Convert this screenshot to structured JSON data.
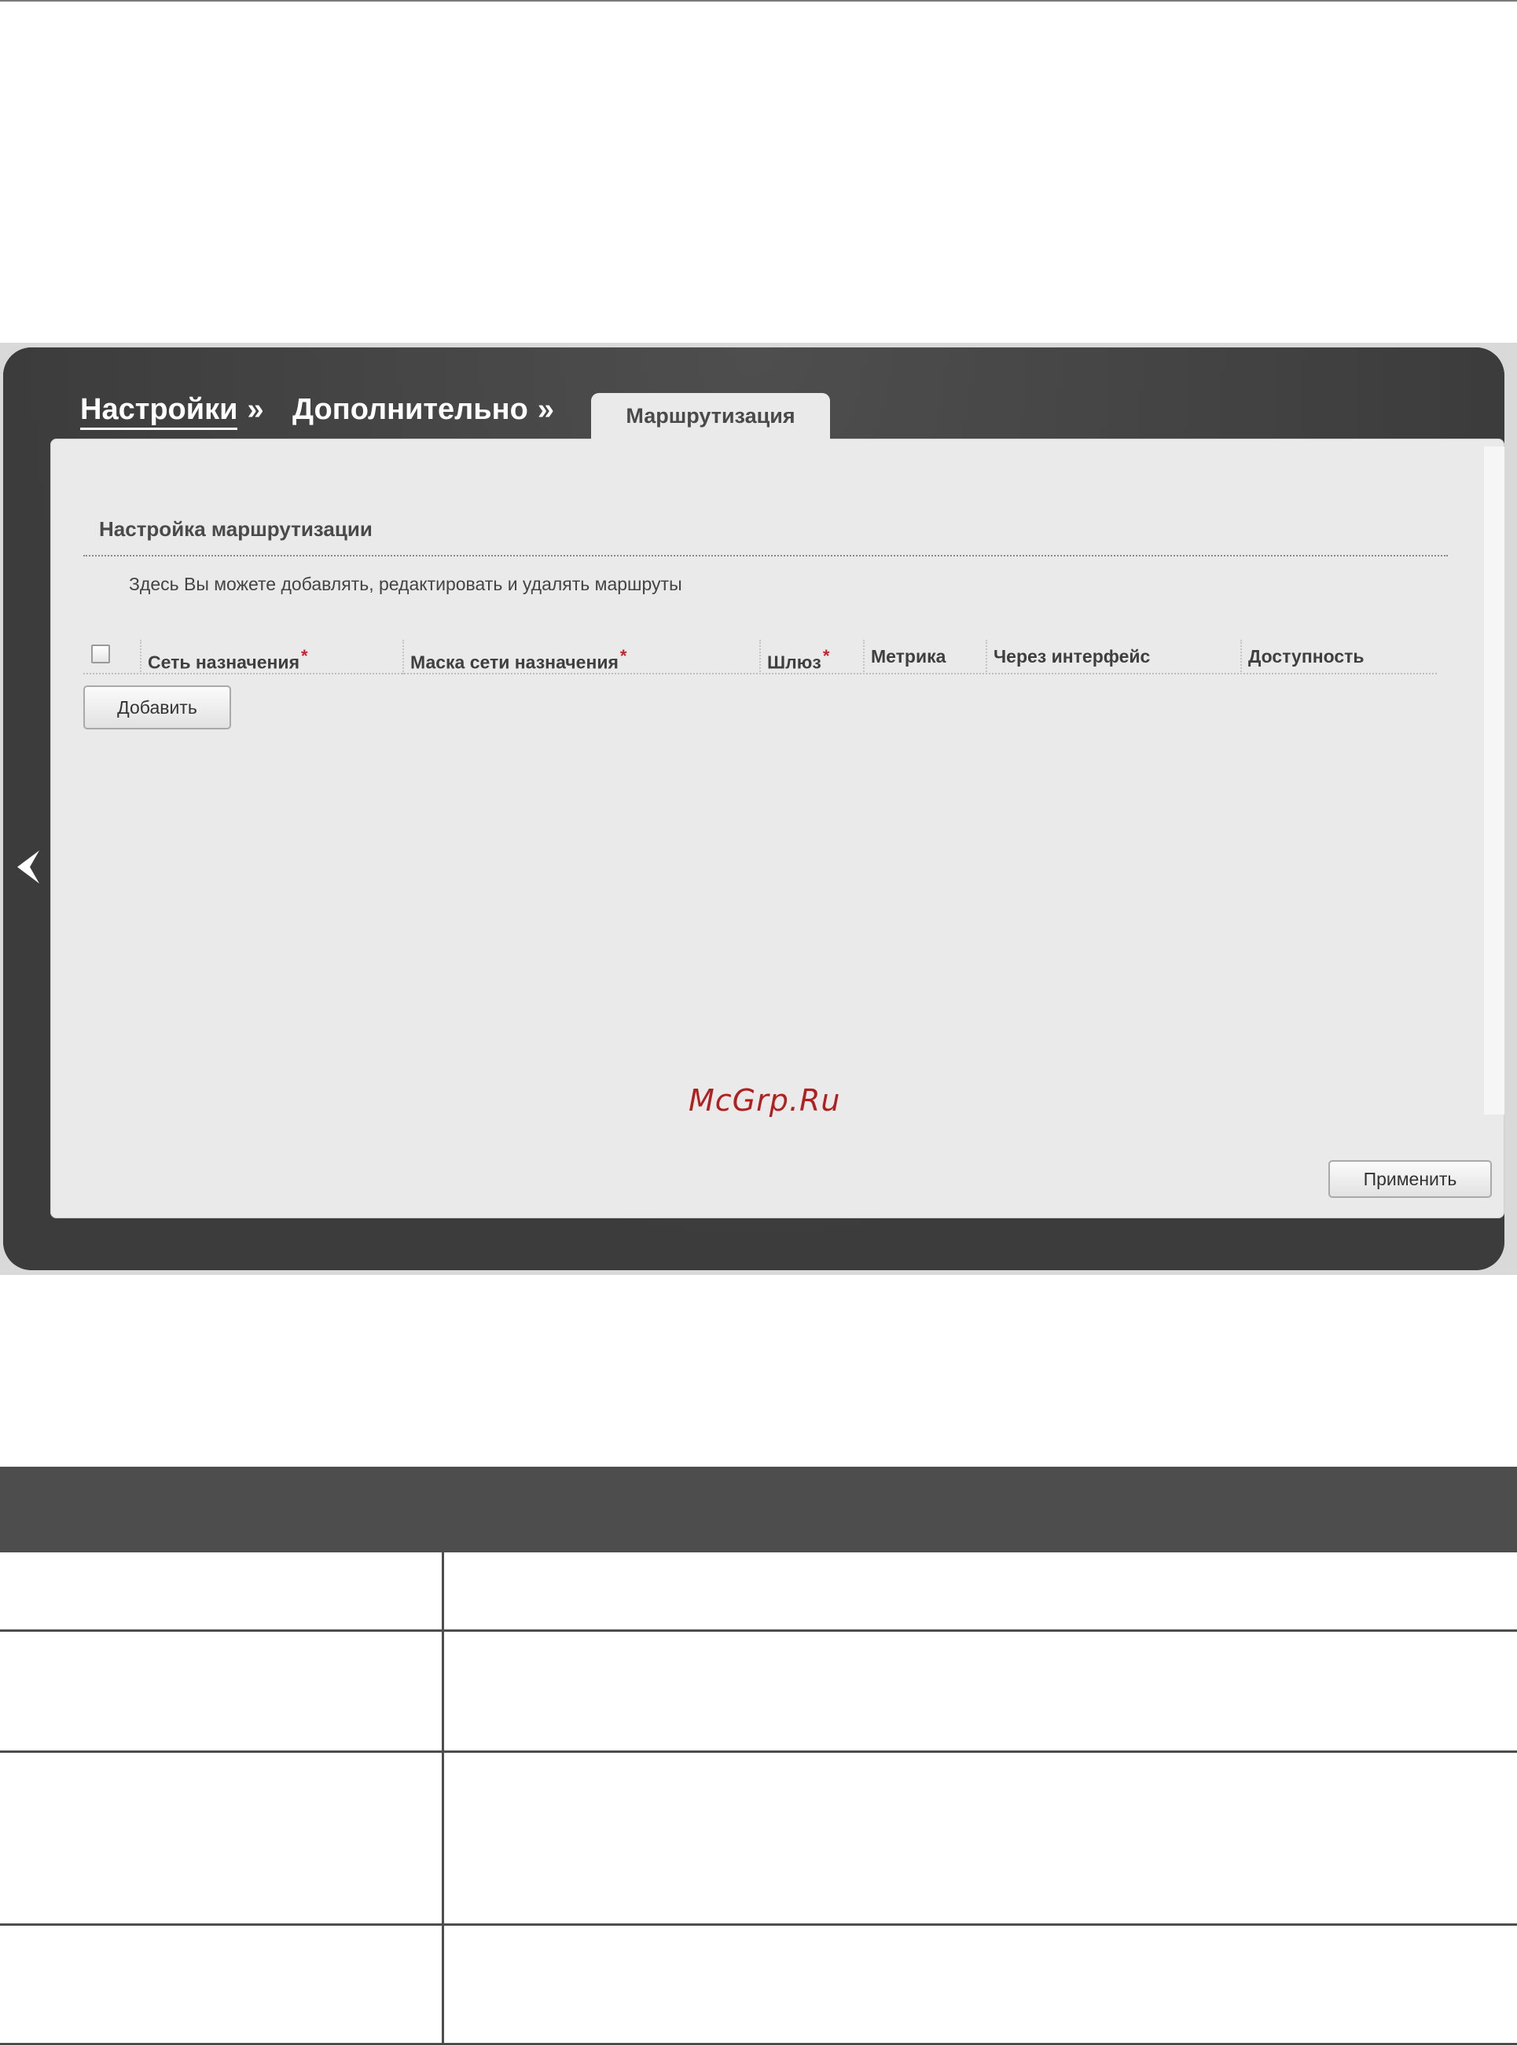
{
  "breadcrumb": {
    "items": [
      {
        "label": "Настройки"
      },
      {
        "label": "Дополнительно"
      }
    ],
    "separator": "»",
    "active_tab": "Маршрутизация"
  },
  "section": {
    "title": "Настройка маршрутизации",
    "description": "Здесь Вы можете добавлять, редактировать и удалять маршруты"
  },
  "routes_table": {
    "columns": [
      {
        "label": "Сеть назначения",
        "required": "*"
      },
      {
        "label": "Маска сети назначения",
        "required": "*"
      },
      {
        "label": "Шлюз",
        "required": "*"
      },
      {
        "label": "Метрика",
        "required": ""
      },
      {
        "label": "Через интерфейс",
        "required": ""
      },
      {
        "label": "Доступность",
        "required": ""
      }
    ]
  },
  "buttons": {
    "add": "Добавить",
    "apply": "Применить"
  },
  "watermark": "McGrp.Ru",
  "colors": {
    "frame": "#424242",
    "panel": "#eaeaea",
    "required_mark": "#c0262c",
    "table_header": "#4d4d4d"
  },
  "icons": {
    "nav": "chevron-left-icon",
    "select_all": "checkbox-icon"
  }
}
